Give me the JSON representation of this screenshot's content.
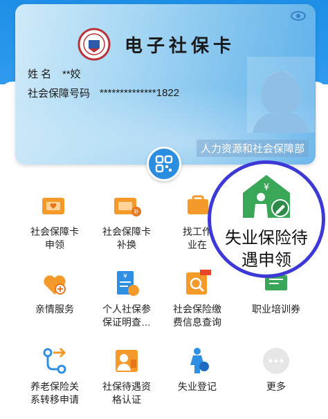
{
  "card": {
    "title": "电子社保卡",
    "name_label": "姓 名",
    "name_value": "**姣",
    "id_label": "社会保障号码",
    "id_value": "**************1822",
    "ministry": "人力资源和社会保障部"
  },
  "services": [
    {
      "label": "社会保障卡\n申领",
      "icon": "card-apply-icon"
    },
    {
      "label": "社会保障卡\n补换",
      "icon": "card-replace-icon"
    },
    {
      "label": "找工作\n业在",
      "icon": "job-search-icon"
    },
    {
      "label": "亲情服务",
      "icon": "family-service-icon"
    },
    {
      "label": "个人社保参\n保证明查…",
      "icon": "insurance-certificate-icon"
    },
    {
      "label": "社会保险缴\n费信息查询",
      "icon": "payment-query-icon"
    },
    {
      "label": "职业培训券",
      "icon": "training-voucher-icon"
    },
    {
      "label": "养老保险关\n系转移申请",
      "icon": "pension-transfer-icon"
    },
    {
      "label": "社保待遇资\n格认证",
      "icon": "benefit-qualification-icon"
    },
    {
      "label": "失业登记",
      "icon": "unemployment-register-icon"
    },
    {
      "label": "更多",
      "icon": "more-icon"
    }
  ],
  "callout": {
    "label": "失业保险待\n遇申领",
    "icon": "unemployment-benefit-icon"
  },
  "colors": {
    "brand_blue": "#1e8fe6",
    "orange": "#f39a2b",
    "highlight_ring": "#3d39d6",
    "green": "#3aa657"
  }
}
